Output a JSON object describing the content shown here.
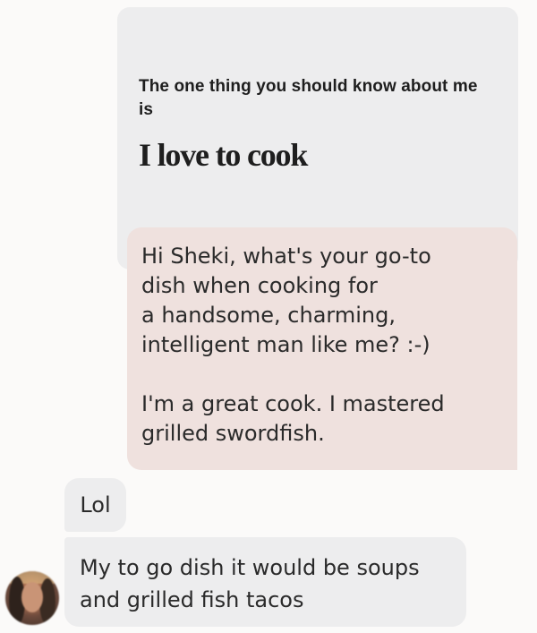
{
  "prompt_card": {
    "question": "The one thing you should know about me is",
    "answer": "I love to cook"
  },
  "sent_message": {
    "text": "Hi Sheki, what's your go-to\ndish when cooking for\na handsome, charming,\nintelligent man like me? :-)\n\nI'm a great cook. I mastered\ngrilled swordfish."
  },
  "received_messages": [
    {
      "text": "Lol"
    },
    {
      "text": "My to go dish it would be soups\nand grilled fish tacos"
    }
  ],
  "colors": {
    "prompt_card_bg": "#ededee",
    "sent_bubble_bg": "#efe1de",
    "received_bubble_bg": "#ededee",
    "page_bg": "#fbfaf9"
  }
}
